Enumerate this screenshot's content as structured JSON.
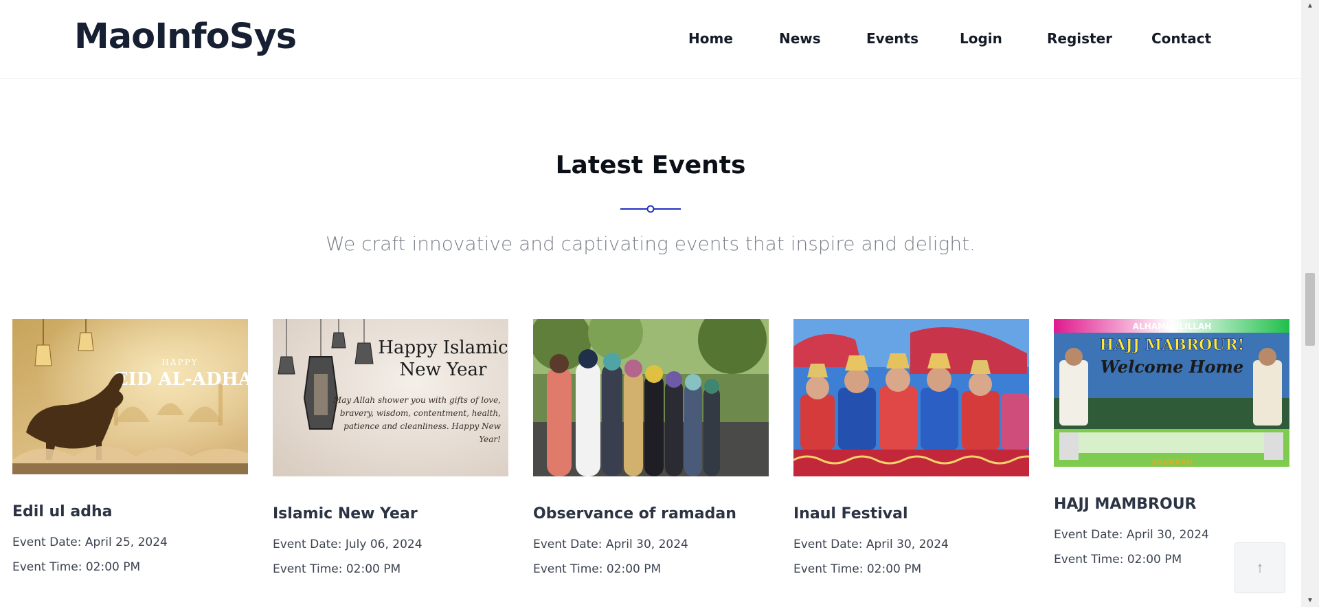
{
  "brand": {
    "logo": "MaoInfoSys"
  },
  "nav": {
    "items": [
      "Home",
      "News",
      "Events",
      "Login",
      "Register",
      "Contact"
    ]
  },
  "section": {
    "title": "Latest Events",
    "subtitle": "We craft innovative and captivating events that inspire and delight."
  },
  "events": [
    {
      "title": "Edil ul adha",
      "date": "Event Date: April 25, 2024",
      "time": "Event Time: 02:00 PM",
      "image_text": [
        "HAPPY",
        "EID AL-ADHA"
      ]
    },
    {
      "title": "Islamic New Year",
      "date": "Event Date: July 06, 2024",
      "time": "Event Time: 02:00 PM",
      "image_text": [
        "Happy Islamic",
        "New Year",
        "May Allah shower you with gifts of love,",
        "bravery, wisdom, contentment, health,",
        "patience and cleanliness. Happy New",
        "Year!"
      ]
    },
    {
      "title": "Observance of ramadan",
      "date": "Event Date: April 30, 2024",
      "time": "Event Time: 02:00 PM",
      "image_text": []
    },
    {
      "title": "Inaul Festival",
      "date": "Event Date: April 30, 2024",
      "time": "Event Time: 02:00 PM",
      "image_text": []
    },
    {
      "title": "HAJJ MAMBROUR",
      "date": "Event Date: April 30, 2024",
      "time": "Event Time: 02:00 PM",
      "image_text": [
        "ALHAMDULILLAH",
        "HAJJ MABROUR!",
        "Welcome Home",
        "SHUKRAN"
      ]
    }
  ],
  "colors": {
    "accent": "#1f2fbf",
    "heading": "#0b0f17",
    "muted": "#7a7f88"
  },
  "back_to_top": {
    "icon": "arrow-up-icon",
    "glyph": "↑"
  }
}
